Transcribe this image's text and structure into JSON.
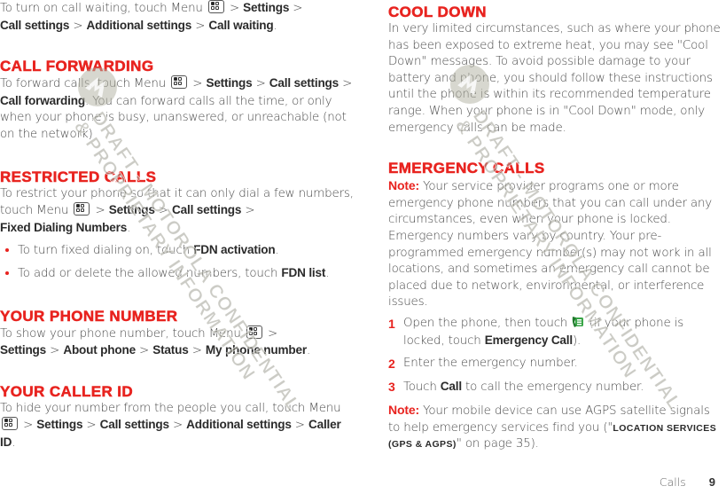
{
  "left": {
    "intro": {
      "text1": "To turn on call waiting, touch Menu",
      "sep": ">",
      "b1": "Settings",
      "b2": "Call settings",
      "b3": "Additional settings",
      "b4": "Call waiting",
      "end": "."
    },
    "call_forwarding": {
      "heading": "Call forwarding",
      "text1": "To forward calls, touch Menu",
      "b1": "Settings",
      "b2": "Call settings",
      "b3": "Call forwarding",
      "text2": ". You can forward calls all the time, or only when your phone is busy, unanswered, or unreachable (not on the network)"
    },
    "restricted_calls": {
      "heading": "Restricted calls",
      "text1": "To restrict your phone so that it can only dial a few numbers, touch Menu",
      "b1": "Settings",
      "b2": "Call settings",
      "b3": "Fixed Dialing Numbers",
      "end": ".",
      "bullets": [
        {
          "text": "To turn fixed dialing on, touch ",
          "bold": "FDN activation",
          "end": "."
        },
        {
          "text": "To add or delete the allowed numbers, touch ",
          "bold": "FDN list",
          "end": "."
        }
      ]
    },
    "your_phone_number": {
      "heading": "Your phone number",
      "text1": "To show your phone number, touch Menu",
      "b1": "Settings",
      "b2": "About phone",
      "b3": "Status",
      "b4": "My phone number",
      "end": "."
    },
    "your_caller_id": {
      "heading": "Your caller ID",
      "text1": "To hide your number from the people you call, touch Menu",
      "b1": "Settings",
      "b2": "Call settings",
      "b3": "Additional settings",
      "b4": "Caller ID",
      "end": "."
    }
  },
  "right": {
    "cool_down": {
      "heading": "Cool down",
      "text": "In very limited circumstances, such as where your phone has been exposed to extreme heat, you may see \"Cool Down\" messages. To avoid possible damage to your battery and phone, you should follow these instructions until the phone is within its recommended temperature range. When your phone is in \"Cool Down\" mode, only emergency calls can be made."
    },
    "emergency_calls": {
      "heading": "Emergency calls",
      "note_label": "Note:",
      "note_text": " Your service provider programs one or more emergency phone numbers that you can call under any circumstances, even when your phone is locked. Emergency numbers vary by country. Your pre-programmed emergency number(s) may not work in all locations, and sometimes an emergency call cannot be placed due to network, environmental, or interference issues.",
      "steps": [
        {
          "num": "1",
          "text1": "Open the phone, then touch",
          "text2": " (if your phone is locked, touch ",
          "bold": "Emergency Call",
          "end": ")."
        },
        {
          "num": "2",
          "text1": "Enter the emergency number."
        },
        {
          "num": "3",
          "text1": "Touch ",
          "bold": "Call",
          "end": " to call the emergency number."
        }
      ],
      "note2_label": "Note:",
      "note2_text": " Your mobile device can use AGPS satellite signals to help emergency services find you (\"",
      "note2_link": "Location services (GPS & AGPS)",
      "note2_end": "\" on page 35)."
    }
  },
  "footer": {
    "section": "Calls",
    "page": "9"
  },
  "watermark": {
    "line1": "DRAFT - MOTOROLA CONFIDENTIAL",
    "line2": "& PROPRIETARY INFORMATION"
  },
  "icons": {
    "menu": "menu-key-icon",
    "phone": "phone-dialer-icon"
  }
}
